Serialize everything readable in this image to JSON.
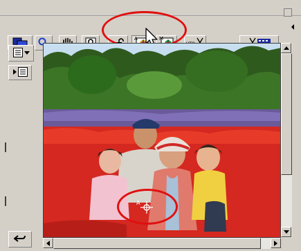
{
  "toolbar": {
    "tools": [
      {
        "name": "screen-mode-icon"
      },
      {
        "name": "zoom-icon"
      },
      {
        "name": "hand-icon"
      },
      {
        "name": "lock-icon"
      },
      {
        "name": "lock-open-icon"
      },
      {
        "name": "auto-point-icon",
        "badge": "A"
      },
      {
        "name": "manual-point-icon",
        "badge": "M"
      },
      {
        "name": "auto-scissors-icon",
        "badge": "UTO"
      },
      {
        "name": "film-scissors-icon"
      }
    ],
    "selected_tool": "auto-point-icon"
  },
  "canvas": {
    "cursor_badge": "A",
    "image_subject": "family-photo"
  },
  "left_panel": {
    "icons": [
      "view-menu-icon",
      "view-submenu-icon",
      "undo-icon"
    ]
  },
  "colors": {
    "annotation_ring": "#e01010",
    "window_bg": "#d4d0c8"
  }
}
